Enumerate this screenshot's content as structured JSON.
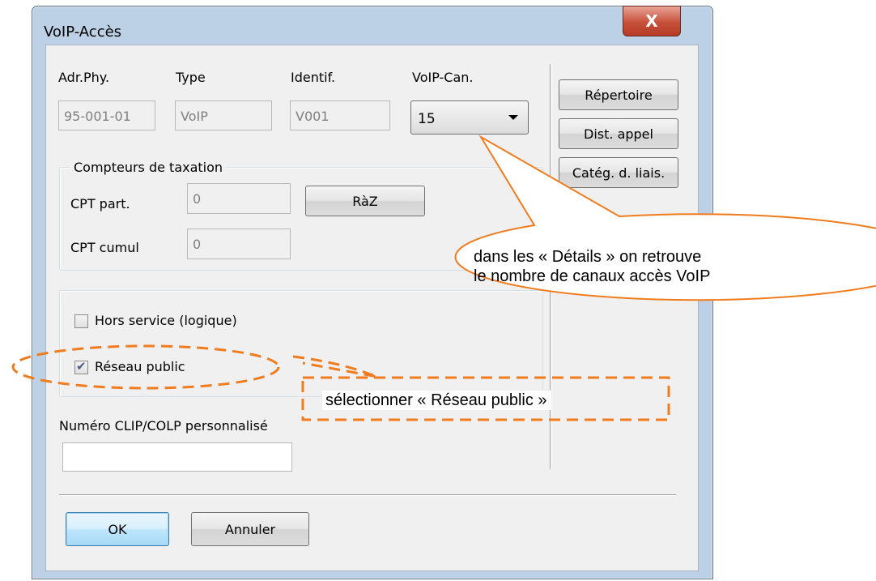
{
  "window": {
    "title": "VoIP-Accès",
    "close_symbol": "X"
  },
  "access": {
    "adr_label": "Adr.Phy.",
    "adr_value": "95-001-01",
    "type_label": "Type",
    "type_value": "VoIP",
    "ident_label": "Identif.",
    "ident_value": "V001",
    "can_label": "VoIP-Can.",
    "can_value": "15"
  },
  "side_buttons": {
    "repertoire": "Répertoire",
    "dist": "Dist. appel",
    "categ": "Catég. d. liais."
  },
  "counters": {
    "group_label": "Compteurs de taxation",
    "cpt_part_label": "CPT part.",
    "cpt_part_value": "0",
    "raz_label": "RàZ",
    "cpt_cumul_label": "CPT cumul",
    "cpt_cumul_value": "0"
  },
  "options": {
    "hors_service_label": "Hors service (logique)",
    "hors_service_checked": false,
    "reseau_public_label": "Réseau public",
    "reseau_public_checked": true
  },
  "clip": {
    "label": "Numéro CLIP/COLP personnalisé",
    "value": ""
  },
  "footer": {
    "ok": "OK",
    "cancel": "Annuler"
  },
  "annotations": {
    "callout_line1": "dans les « Détails » on retrouve",
    "callout_line2": "le nombre de canaux accès VoIP",
    "note": "sélectionner « Réseau public »",
    "color": "#f07c1e"
  }
}
